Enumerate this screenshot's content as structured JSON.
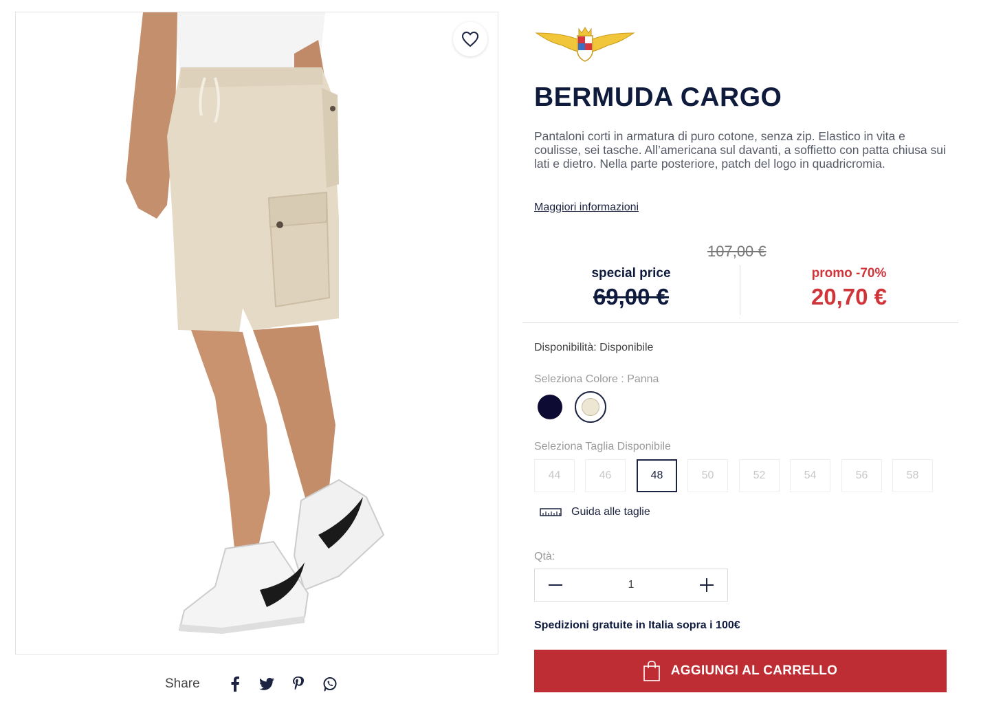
{
  "product": {
    "title": "BERMUDA CARGO",
    "description": "Pantaloni corti in armatura di puro cotone, senza zip. Elastico in vita e coulisse, sei tasche. All’americana sul davanti, a soffietto con patta chiusa sui lati e dietro. Nella parte posteriore, patch del logo in quadricromia.",
    "more_info_link": "Maggiori informazioni"
  },
  "pricing": {
    "original_price": "107,00 €",
    "special_label": "special price",
    "special_price": "69,00 €",
    "promo_label": "promo -70%",
    "promo_price": "20,70 €"
  },
  "availability": "Disponibilità: Disponibile",
  "color": {
    "label": "Seleziona Colore : Panna",
    "options": [
      {
        "color": "#0d0a33"
      },
      {
        "color": "#ece6d2"
      }
    ],
    "selected_index": 1
  },
  "size": {
    "label": "Seleziona Taglia Disponibile",
    "options": [
      "44",
      "46",
      "48",
      "50",
      "52",
      "54",
      "56",
      "58"
    ],
    "selected": "48"
  },
  "size_guide": "Guida alle taglie",
  "quantity": {
    "label": "Qtà:",
    "value": "1"
  },
  "shipping_note": "Spedizioni gratuite in Italia sopra i 100€",
  "cart_button": "AGGIUNGI AL CARRELLO",
  "share": {
    "label": "Share",
    "icons": [
      "facebook-icon",
      "twitter-icon",
      "pinterest-icon",
      "whatsapp-icon"
    ]
  },
  "colors": {
    "brand_navy": "#0f1b3d",
    "promo_red": "#d0353a",
    "button_red": "#bd2d33"
  }
}
